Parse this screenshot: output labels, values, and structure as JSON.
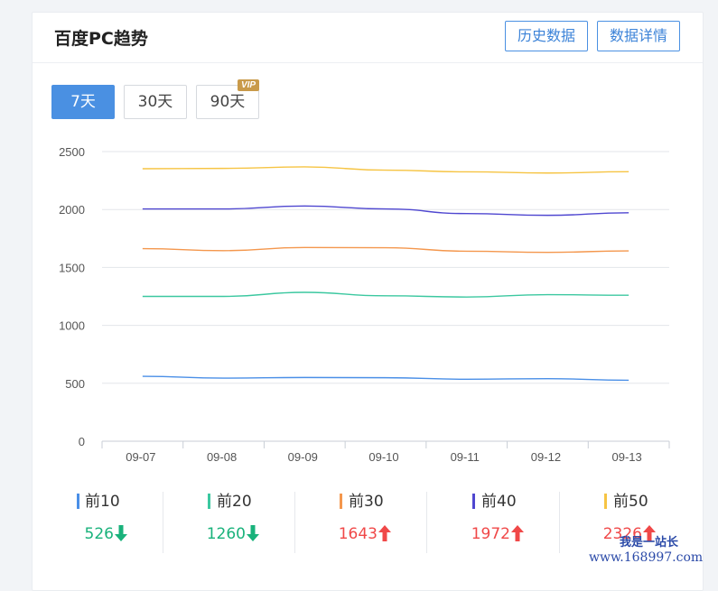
{
  "header": {
    "title": "百度PC趋势",
    "history_button": "历史数据",
    "detail_button": "数据详情"
  },
  "range_buttons": [
    {
      "label": "7天",
      "active": true
    },
    {
      "label": "30天",
      "active": false
    },
    {
      "label": "90天",
      "active": false,
      "badge": "VIP"
    }
  ],
  "chart_data": {
    "type": "line",
    "title": "",
    "xlabel": "",
    "ylabel": "",
    "x": [
      "09-07",
      "09-08",
      "09-09",
      "09-10",
      "09-11",
      "09-12",
      "09-13"
    ],
    "yticks": [
      0,
      500,
      1000,
      1500,
      2000,
      2500
    ],
    "ylim": [
      0,
      2500
    ],
    "grid": true,
    "series": [
      {
        "name": "前10",
        "color": "#4a8fe7",
        "values": [
          560,
          545,
          550,
          548,
          535,
          540,
          526
        ]
      },
      {
        "name": "前20",
        "color": "#3cc8a0",
        "values": [
          1250,
          1250,
          1285,
          1255,
          1245,
          1265,
          1260
        ]
      },
      {
        "name": "前30",
        "color": "#f4974d",
        "values": [
          1662,
          1645,
          1672,
          1670,
          1640,
          1630,
          1643
        ]
      },
      {
        "name": "前40",
        "color": "#4f47d0",
        "values": [
          2005,
          2005,
          2030,
          2005,
          1965,
          1950,
          1972
        ]
      },
      {
        "name": "前50",
        "color": "#f6c443",
        "values": [
          2352,
          2355,
          2368,
          2340,
          2325,
          2315,
          2326
        ]
      }
    ]
  },
  "stats": [
    {
      "label": "前10",
      "value": "526",
      "trend": "down",
      "color": "#4a8fe7"
    },
    {
      "label": "前20",
      "value": "1260",
      "trend": "down",
      "color": "#3cc8a0"
    },
    {
      "label": "前30",
      "value": "1643",
      "trend": "up",
      "color": "#f4974d"
    },
    {
      "label": "前40",
      "value": "1972",
      "trend": "up",
      "color": "#4f47d0"
    },
    {
      "label": "前50",
      "value": "2326",
      "trend": "up",
      "color": "#f6c443"
    }
  ],
  "colors": {
    "up": "#f04848",
    "down": "#19b27b",
    "accent": "#4a90e2"
  },
  "watermark": {
    "line1": "我是一站长",
    "line2": "www.168997.com"
  }
}
